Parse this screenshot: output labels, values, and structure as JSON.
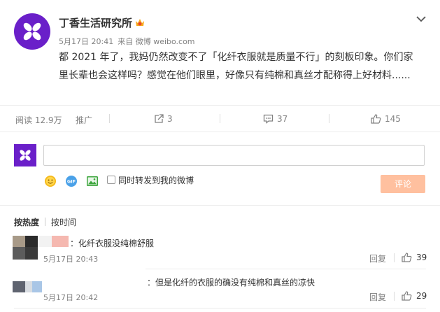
{
  "post": {
    "author": "丁香生活研究所",
    "date": "5月17日 20:41",
    "source": "来自 微博 weibo.com",
    "text": "都 2021 年了，我妈仍然改变不了「化纤衣服就是质量不行」的刻板印象。你们家里长辈也会这样吗？感觉在他们眼里，好像只有纯棉和真丝才配称得上好材料......",
    "icons": [
      "chevron-down-icon",
      "vip-badge-icon"
    ]
  },
  "actions": {
    "reads": "阅读 12.9万",
    "promote": "推广",
    "repost_count": "3",
    "comment_count": "37",
    "like_count": "145",
    "icons": [
      "share-icon",
      "comment-icon",
      "thumbs-up-icon"
    ]
  },
  "composer": {
    "also_repost_label": "同时转发到我的微博",
    "submit_label": "评论",
    "icons": [
      "emoji-icon",
      "gif-icon",
      "image-icon"
    ]
  },
  "sort": {
    "hot": "按热度",
    "time": "按时间"
  },
  "comments": [
    {
      "text": "：化纤衣服没纯棉舒服",
      "date": "5月17日 20:43",
      "reply": "回复",
      "likes": "39"
    },
    {
      "text": "：但是化纤的衣服的确没有纯棉和真丝的凉快",
      "date": "5月17日 20:42",
      "reply": "回复",
      "likes": "29"
    }
  ],
  "colors": {
    "brand_avatar": "#6a1fc9",
    "submit_bg": "#ffc09f",
    "emoji_yellow": "#f5b91a",
    "gif_blue": "#4aa1e8",
    "image_green": "#3ea63e"
  }
}
